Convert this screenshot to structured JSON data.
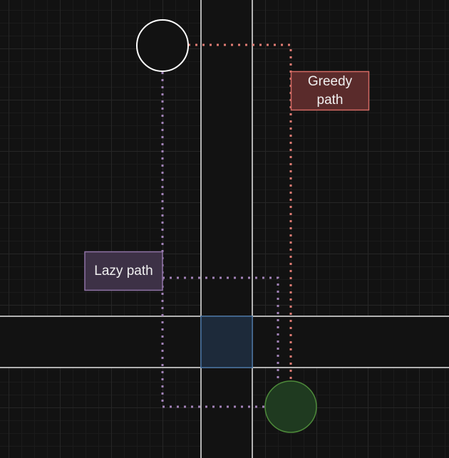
{
  "labels": {
    "greedy_path": "Greedy\npath",
    "lazy_path": "Lazy path"
  },
  "colors": {
    "background": "#121212",
    "road_fill": "#121212",
    "road_lines": "#e6e6e6",
    "start_circle_stroke": "#ffffff",
    "goal_circle_fill": "#1f3a20",
    "goal_circle_stroke": "#4d8a3a",
    "intersection_fill": "#1d2a3a",
    "intersection_stroke": "#3f6a99",
    "greedy_path": "#e07b73",
    "greedy_box_fill": "#5a2b2b",
    "greedy_box_stroke": "#d46a64",
    "lazy_path": "#a282b8",
    "lazy_box_fill": "#3d3146",
    "lazy_box_stroke": "#8f73a6"
  }
}
